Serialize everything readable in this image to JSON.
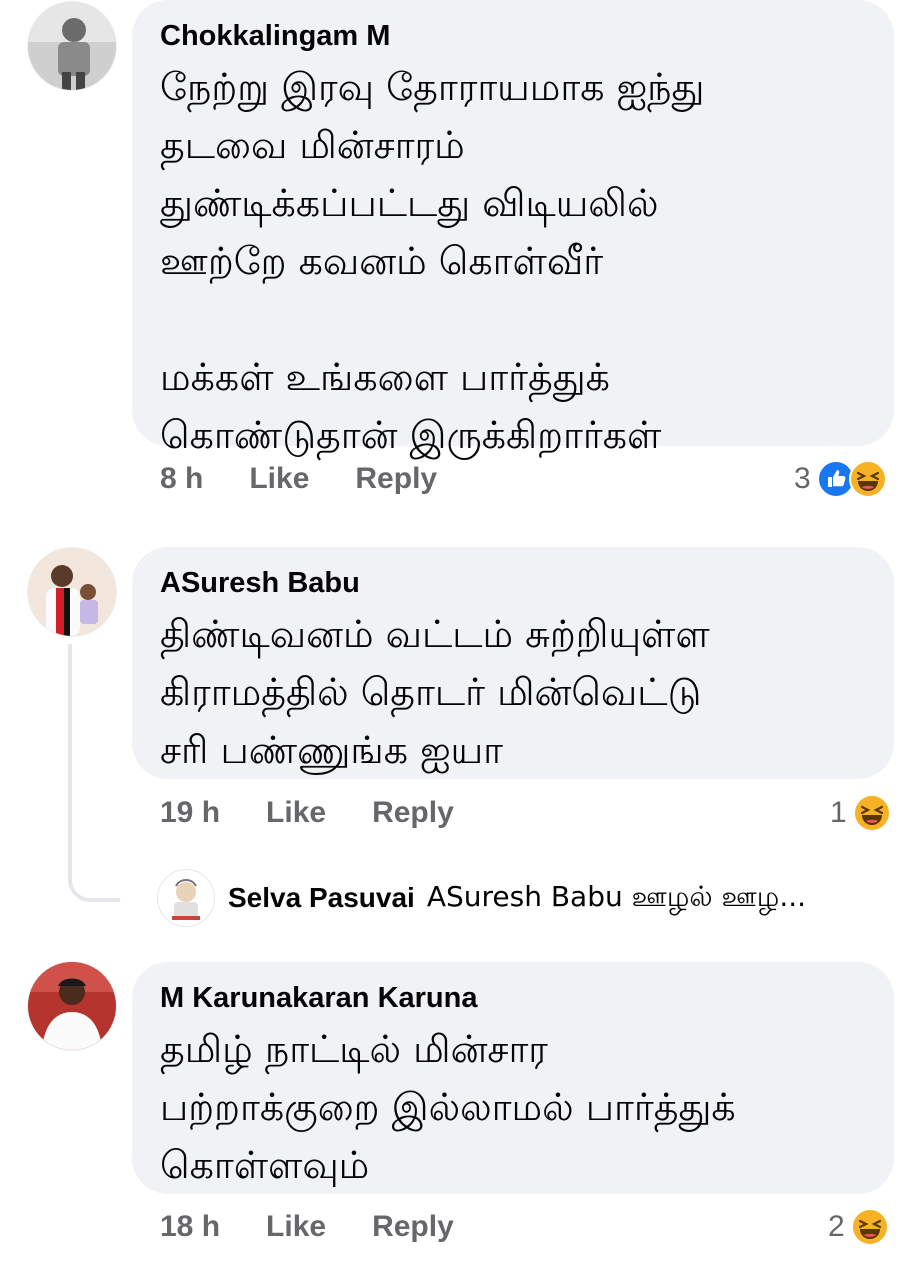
{
  "comments": [
    {
      "author": "Chokkalingam M",
      "text": "நேற்று இரவு தோராயமாக ஐந்து\nதடவை மின்சாரம்\nதுண்டிக்கப்பட்டது விடியலில்\nஊற்றே கவனம் கொள்வீர்\n\nமக்கள் உங்களை பார்த்துக்\nகொண்டுதான் இருக்கிறார்கள்",
      "time": "8 h",
      "like_label": "Like",
      "reply_label": "Reply",
      "reaction_count": "3",
      "reactions": [
        "like-icon",
        "haha-icon"
      ]
    },
    {
      "author": "ASuresh Babu",
      "text": "திண்டிவனம் வட்டம்   சுற்றியுள்ள\nகிராமத்தில் தொடர் மின்வெட்டு\nசரி பண்ணுங்க ஐயா",
      "time": "19 h",
      "like_label": "Like",
      "reply_label": "Reply",
      "reaction_count": "1",
      "reactions": [
        "haha-icon"
      ],
      "reply_preview": {
        "author": "Selva Pasuvai",
        "text": "ASuresh Babu ஊழல் ஊழ..."
      }
    },
    {
      "author": "M Karunakaran Karuna",
      "text": "தமிழ் நாட்டில் மின்சார\nபற்றாக்குறை இல்லாமல் பார்த்துக்\nகொள்ளவும்",
      "time": "18 h",
      "like_label": "Like",
      "reply_label": "Reply",
      "reaction_count": "2",
      "reactions": [
        "haha-icon"
      ]
    }
  ],
  "colors": {
    "bubble": "#f0f2f5",
    "meta_text": "#65676b",
    "like_blue": "#1877f2",
    "haha_yellow": "#f7b125"
  }
}
